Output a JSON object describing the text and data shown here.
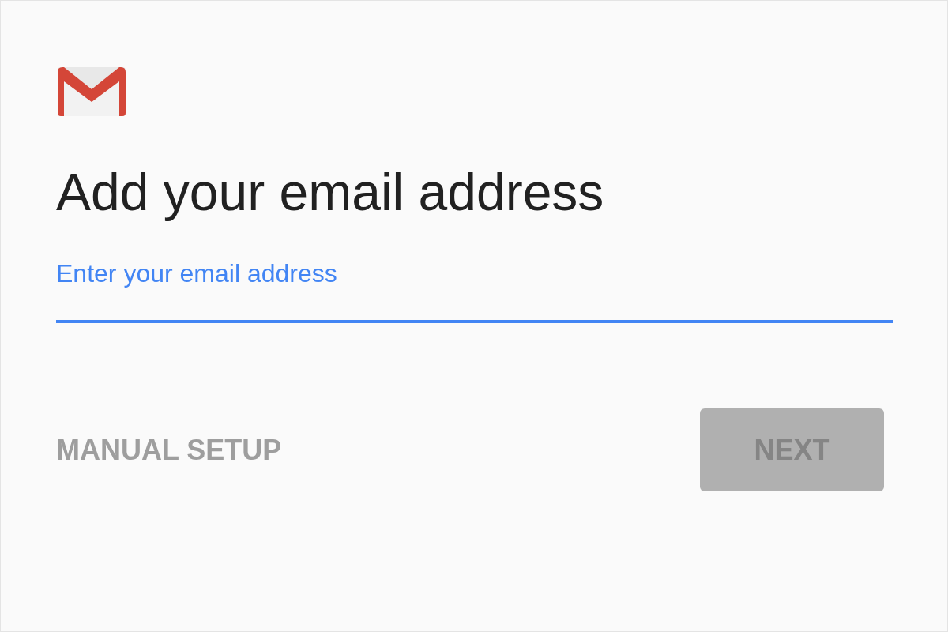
{
  "title": "Add your email address",
  "email_field": {
    "label": "Enter your email address",
    "focused": true
  },
  "buttons": [
    {
      "label": "MANUAL SETUP",
      "kind": "text",
      "disabled": false
    },
    {
      "label": "NEXT",
      "kind": "raised",
      "disabled": true
    }
  ]
}
